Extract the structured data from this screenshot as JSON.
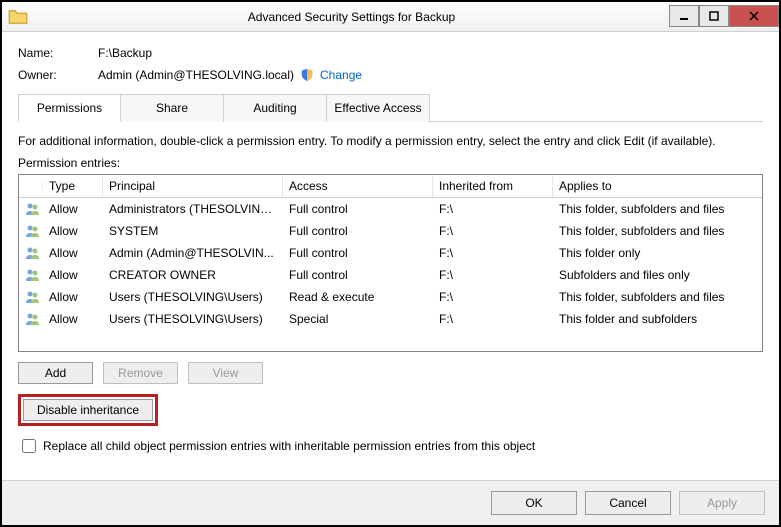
{
  "window": {
    "title": "Advanced Security Settings for Backup"
  },
  "header": {
    "name_label": "Name:",
    "name_value": "F:\\Backup",
    "owner_label": "Owner:",
    "owner_value": "Admin (Admin@THESOLVING.local)",
    "change_link": "Change"
  },
  "tabs": {
    "permissions": "Permissions",
    "share": "Share",
    "auditing": "Auditing",
    "effective": "Effective Access"
  },
  "info_text": "For additional information, double-click a permission entry. To modify a permission entry, select the entry and click Edit (if available).",
  "entries_label": "Permission entries:",
  "columns": {
    "type": "Type",
    "principal": "Principal",
    "access": "Access",
    "inherited": "Inherited from",
    "applies": "Applies to"
  },
  "rows": [
    {
      "type": "Allow",
      "principal": "Administrators (THESOLVING...",
      "access": "Full control",
      "inherited": "F:\\",
      "applies": "This folder, subfolders and files"
    },
    {
      "type": "Allow",
      "principal": "SYSTEM",
      "access": "Full control",
      "inherited": "F:\\",
      "applies": "This folder, subfolders and files"
    },
    {
      "type": "Allow",
      "principal": "Admin (Admin@THESOLVIN...",
      "access": "Full control",
      "inherited": "F:\\",
      "applies": "This folder only"
    },
    {
      "type": "Allow",
      "principal": "CREATOR OWNER",
      "access": "Full control",
      "inherited": "F:\\",
      "applies": "Subfolders and files only"
    },
    {
      "type": "Allow",
      "principal": "Users (THESOLVING\\Users)",
      "access": "Read & execute",
      "inherited": "F:\\",
      "applies": "This folder, subfolders and files"
    },
    {
      "type": "Allow",
      "principal": "Users (THESOLVING\\Users)",
      "access": "Special",
      "inherited": "F:\\",
      "applies": "This folder and subfolders"
    }
  ],
  "buttons": {
    "add": "Add",
    "remove": "Remove",
    "view": "View",
    "disable": "Disable inheritance",
    "ok": "OK",
    "cancel": "Cancel",
    "apply": "Apply"
  },
  "replace_label": "Replace all child object permission entries with inheritable permission entries from this object"
}
